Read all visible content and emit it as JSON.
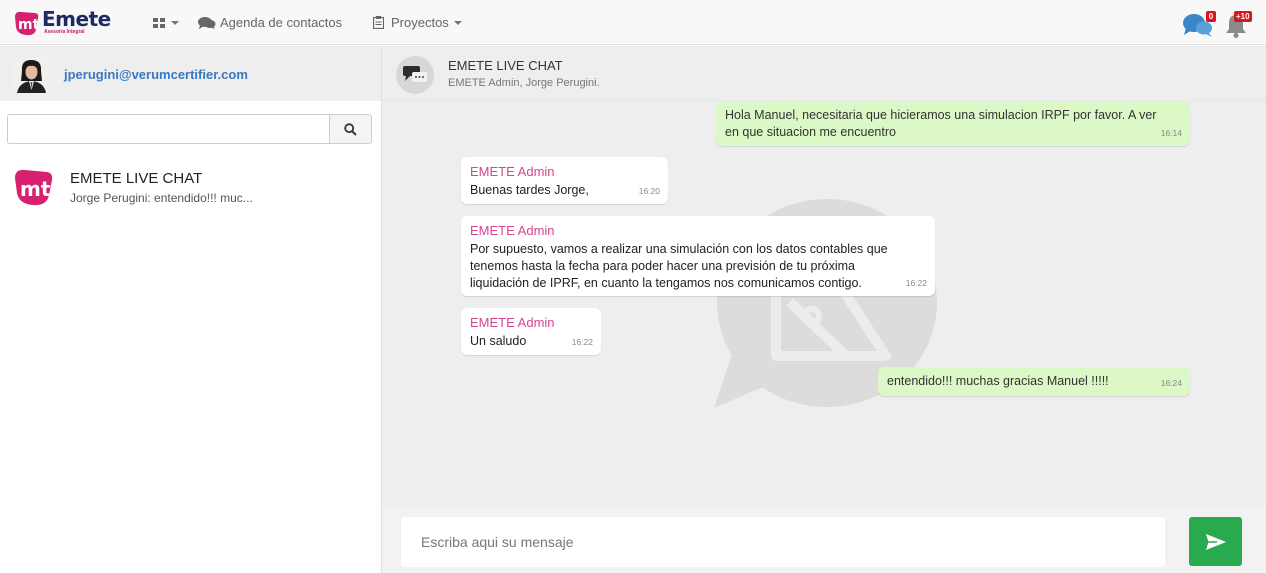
{
  "app": {
    "brand_name": "Emete",
    "brand_subtitle": "Asesoría Integral"
  },
  "nav": {
    "contacts_label": "Agenda de contactos",
    "projects_label": "Proyectos",
    "chat_badge": "0",
    "notifications_badge": "+10"
  },
  "sidebar": {
    "user_email": "jperugini@verumcertifier.com",
    "search_placeholder": "",
    "conversations": [
      {
        "title": "EMETE LIVE CHAT",
        "preview": "Jorge Perugini: entendido!!! muc..."
      }
    ]
  },
  "chat": {
    "title": "EMETE LIVE CHAT",
    "members": "EMETE Admin, Jorge Perugini.",
    "messages": [
      {
        "direction": "out",
        "sender": "",
        "text": "Hola Manuel, necesitaria que hicieramos una simulacion IRPF por favor. A ver en que situacion me encuentro",
        "time": "16:14"
      },
      {
        "direction": "in",
        "sender": "EMETE Admin",
        "text": "Buenas tardes Jorge,",
        "time": "16:20"
      },
      {
        "direction": "in",
        "sender": "EMETE Admin",
        "text": "Por supuesto, vamos a realizar una simulación con los datos contables que tenemos hasta la fecha para poder hacer una previsión de tu próxima liquidación de IPRF, en cuanto la tengamos nos comunicamos contigo.",
        "time": "16:22"
      },
      {
        "direction": "in",
        "sender": "EMETE Admin",
        "text": "Un saludo",
        "time": "16:22"
      },
      {
        "direction": "out",
        "sender": "",
        "text": "entendido!!! muchas gracias Manuel !!!!!",
        "time": "16:24"
      }
    ],
    "composer_placeholder": "Escriba aqui su mensaje"
  },
  "colors": {
    "brand_pink": "#d6216f",
    "brand_navy": "#1f2a63",
    "outgoing_bubble": "#dcf8c6",
    "sender_name": "#d4468f",
    "send_button": "#2aaa4f",
    "badge_red": "#d9161c"
  },
  "icons": {
    "grid": "grid-icon",
    "contacts": "comments-icon",
    "projects": "clipboard-icon",
    "chat": "chat-bubbles-icon",
    "bell": "bell-icon",
    "search": "search-icon",
    "send": "paper-plane-icon"
  }
}
